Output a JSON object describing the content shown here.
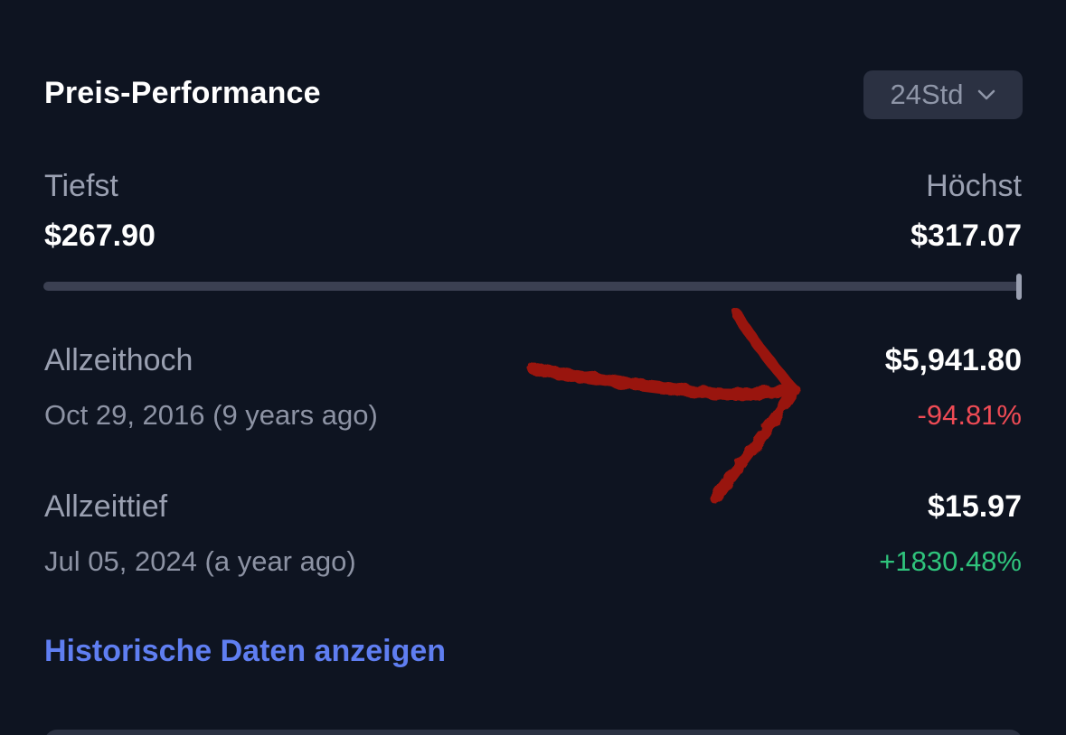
{
  "header": {
    "title": "Preis-Performance",
    "range_select": {
      "value": "24Std",
      "icon": "chevron-down-icon"
    }
  },
  "range_24h": {
    "low_label": "Tiefst",
    "low_value": "$267.90",
    "high_label": "Höchst",
    "high_value": "$317.07",
    "current_position_fraction": 1.0
  },
  "all_time_high": {
    "label": "Allzeithoch",
    "value": "$5,941.80",
    "date": "Oct 29, 2016 (9 years ago)",
    "change": "-94.81%"
  },
  "all_time_low": {
    "label": "Allzeittief",
    "value": "$15.97",
    "date": "Jul 05, 2024 (a year ago)",
    "change": "+1830.48%"
  },
  "historical_link": "Historische Daten anzeigen",
  "annotation": {
    "icon": "hand-drawn-arrow-icon"
  },
  "colors": {
    "background": "#0e1421",
    "negative": "#ef4b55",
    "positive": "#2fc47c",
    "link": "#5f7ef1",
    "annotation": "#a51408"
  }
}
